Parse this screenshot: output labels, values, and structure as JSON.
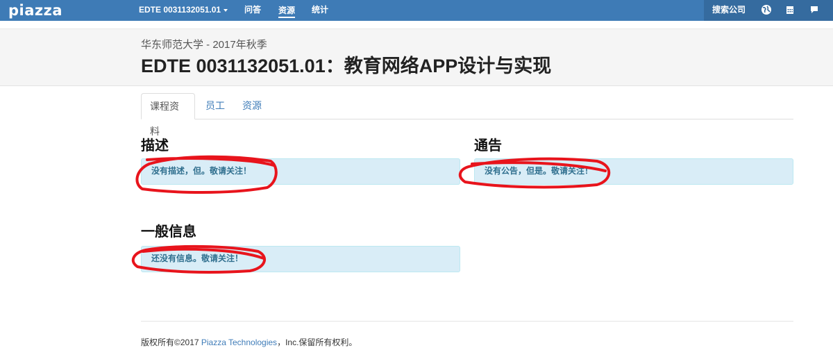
{
  "nav": {
    "logo": "piazza",
    "course": "EDTE 0031132051.01",
    "links": [
      "问答",
      "资源",
      "统计"
    ],
    "active_link": "资源",
    "search_company": "搜索公司"
  },
  "header": {
    "subtitle": "华东师范大学 - 2017年秋季",
    "title": "EDTE 0031132051.01：教育网络APP设计与实现"
  },
  "tabs": [
    "课程资料",
    "员工",
    "资源"
  ],
  "sections": {
    "description": {
      "title": "描述",
      "message": "没有描述，但。敬请关注！"
    },
    "announcements": {
      "title": "通告",
      "message": "没有公告，但是。敬请关注！"
    },
    "general_info": {
      "title": "一般信息",
      "message": "还没有信息。敬请关注！"
    }
  },
  "footer": {
    "prefix": "版权所有©2017 ",
    "company": "Piazza Technologies",
    "suffix": "，Inc.保留所有权利。"
  },
  "colors": {
    "nav_bg": "#3e7bb6",
    "info_bg": "#d9edf7",
    "info_text": "#31708f",
    "annotation": "#e8141c"
  },
  "icons": [
    "globe-icon",
    "calendar-icon",
    "chat-icon",
    "caret-down-icon"
  ]
}
